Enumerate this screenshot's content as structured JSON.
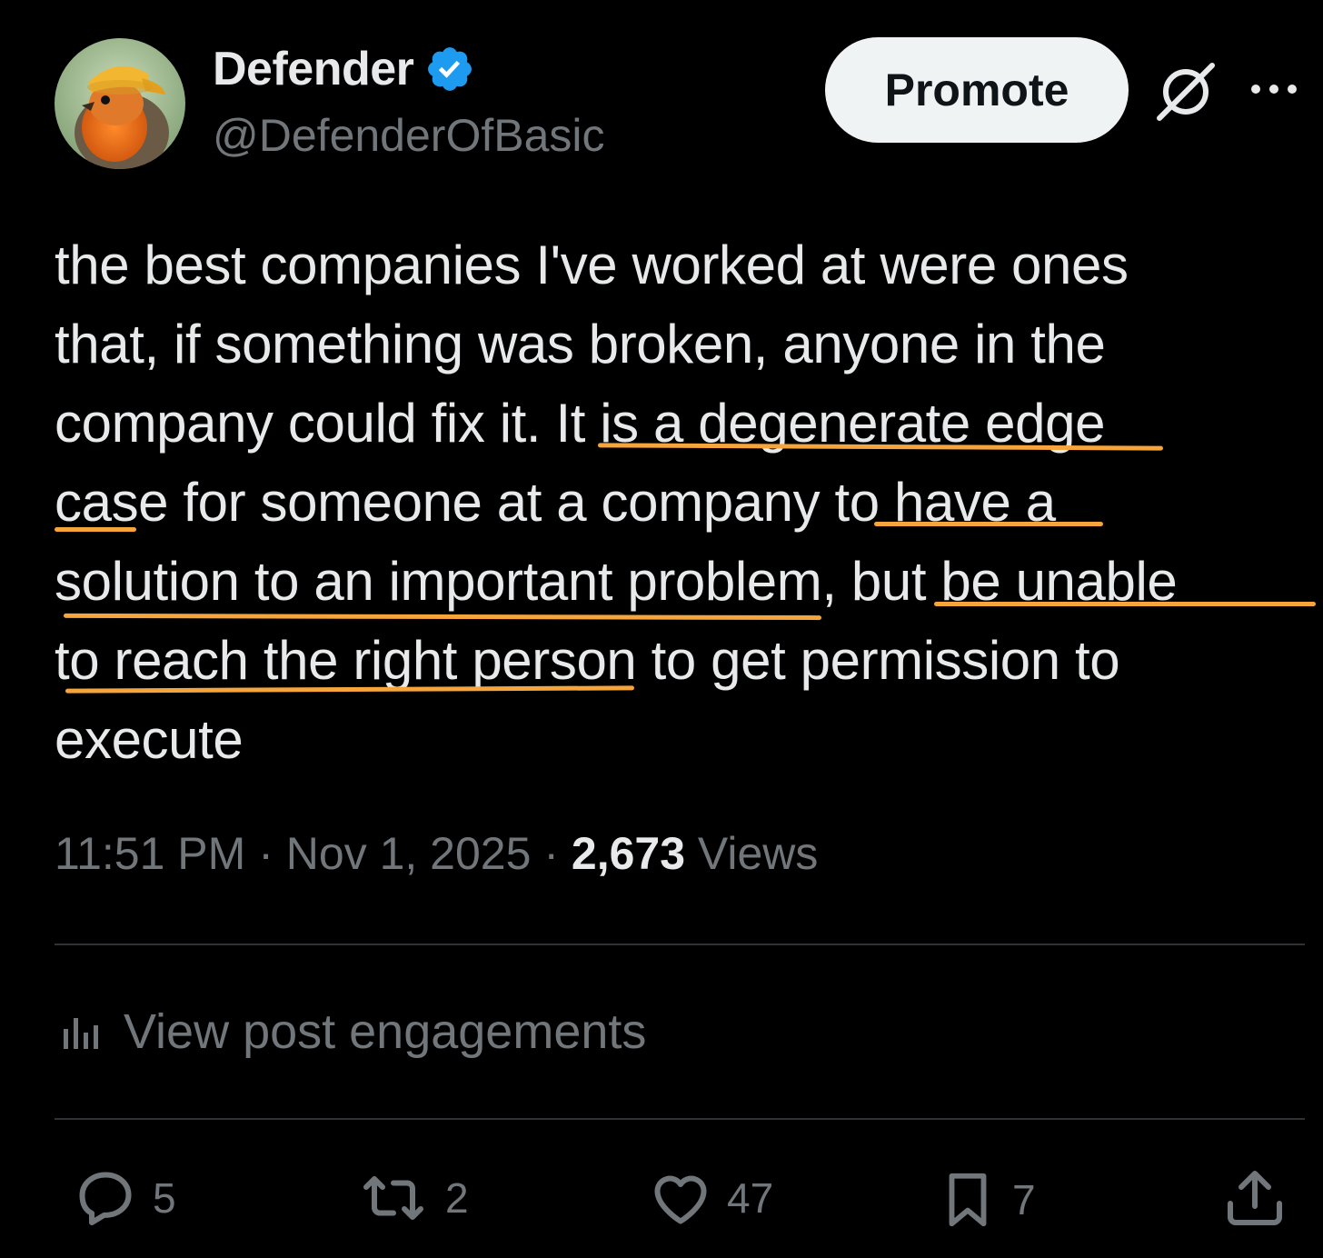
{
  "author": {
    "display_name": "Defender",
    "handle": "@DefenderOfBasic",
    "verified": true
  },
  "header": {
    "promote_label": "Promote",
    "grok_icon": "grok-icon",
    "more_icon": "more-options-icon"
  },
  "tweet": {
    "lines": [
      "the best companies I've worked at were ones",
      "that, if something was broken, anyone in the",
      "company could fix it. It is a degenerate edge",
      "case for someone at a company to have a",
      "solution to an important problem, but be unable",
      "to reach the right person to get permission to",
      "execute"
    ],
    "highlight_color": "#f5a53c"
  },
  "meta": {
    "time": "11:51 PM",
    "separator": "·",
    "date": "Nov 1, 2025",
    "views_count": "2,673",
    "views_label": "Views"
  },
  "engagements": {
    "label": "View post engagements",
    "icon": "bar-chart-icon"
  },
  "actions": {
    "replies": "5",
    "reposts": "2",
    "likes": "47",
    "bookmarks": "7"
  },
  "colors": {
    "background": "#000000",
    "text": "#e7e9ea",
    "muted": "#71767b",
    "verified_blue": "#1d9bf0",
    "divider": "#2f3336"
  }
}
